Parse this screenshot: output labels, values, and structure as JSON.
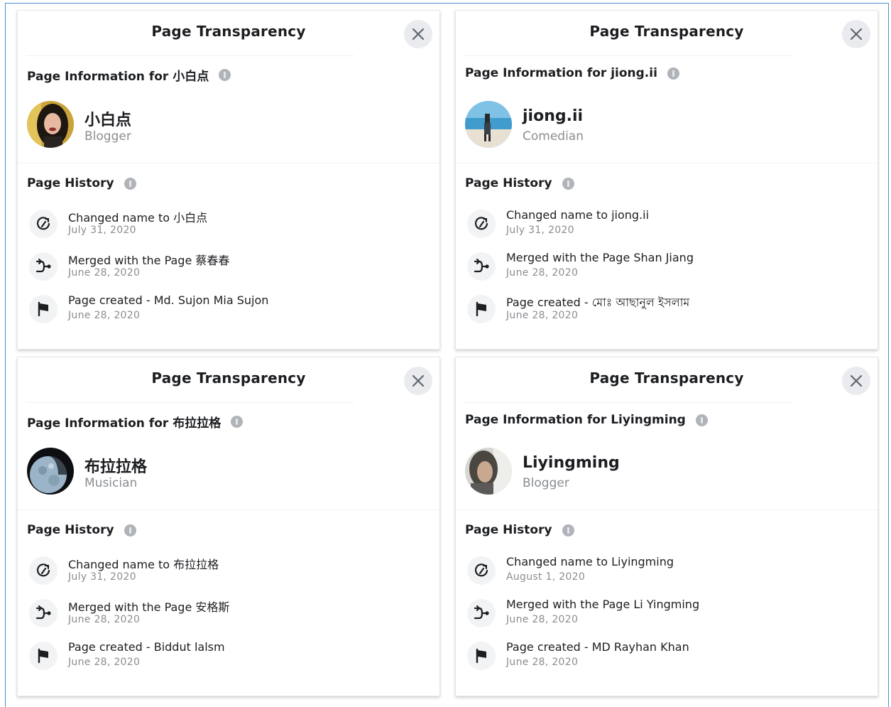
{
  "panels": [
    {
      "title": "Page Transparency",
      "info_label": "Page Information for 小白点",
      "page_name": "小白点",
      "category": "Blogger",
      "avatar": "woman-portrait-avatar",
      "history_label": "Page History",
      "history": [
        {
          "text": "Changed name to 小白点",
          "date": "July 31, 2020",
          "icon": "rename-icon"
        },
        {
          "text": "Merged with the Page 蔡春春",
          "date": "June 28, 2020",
          "icon": "merge-icon"
        },
        {
          "text": "Page created - Md. Sujon Mia Sujon",
          "date": "June 28, 2020",
          "icon": "flag-icon"
        }
      ]
    },
    {
      "title": "Page Transparency",
      "info_label": "Page Information for jiong.ii",
      "page_name": "jiong.ii",
      "category": "Comedian",
      "avatar": "beach-person-avatar",
      "history_label": "Page History",
      "history": [
        {
          "text": "Changed name to jiong.ii",
          "date": "July 31, 2020",
          "icon": "rename-icon"
        },
        {
          "text": "Merged with the Page Shan Jiang",
          "date": "June 28, 2020",
          "icon": "merge-icon"
        },
        {
          "text": "Page created - মোঃ আছানুল ইসলাম",
          "date": "June 28, 2020",
          "icon": "flag-icon"
        }
      ]
    },
    {
      "title": "Page Transparency",
      "info_label": "Page Information for 布拉拉格",
      "page_name": "布拉拉格",
      "category": "Musician",
      "avatar": "moon-avatar",
      "history_label": "Page History",
      "history": [
        {
          "text": "Changed name to 布拉拉格",
          "date": "July 31, 2020",
          "icon": "rename-icon"
        },
        {
          "text": "Merged with the Page 安格斯",
          "date": "June 28, 2020",
          "icon": "merge-icon"
        },
        {
          "text": "Page created - Biddut lalsm",
          "date": "June 28, 2020",
          "icon": "flag-icon"
        }
      ]
    },
    {
      "title": "Page Transparency",
      "info_label": "Page Information for Liyingming",
      "page_name": "Liyingming",
      "category": "Blogger",
      "avatar": "person-portrait-avatar",
      "history_label": "Page History",
      "history": [
        {
          "text": "Changed name to Liyingming",
          "date": "August 1, 2020",
          "icon": "rename-icon"
        },
        {
          "text": "Merged with the Page Li Yingming",
          "date": "June 28, 2020",
          "icon": "merge-icon"
        },
        {
          "text": "Page created - MD Rayhan Khan",
          "date": "June 28, 2020",
          "icon": "flag-icon"
        }
      ]
    }
  ]
}
